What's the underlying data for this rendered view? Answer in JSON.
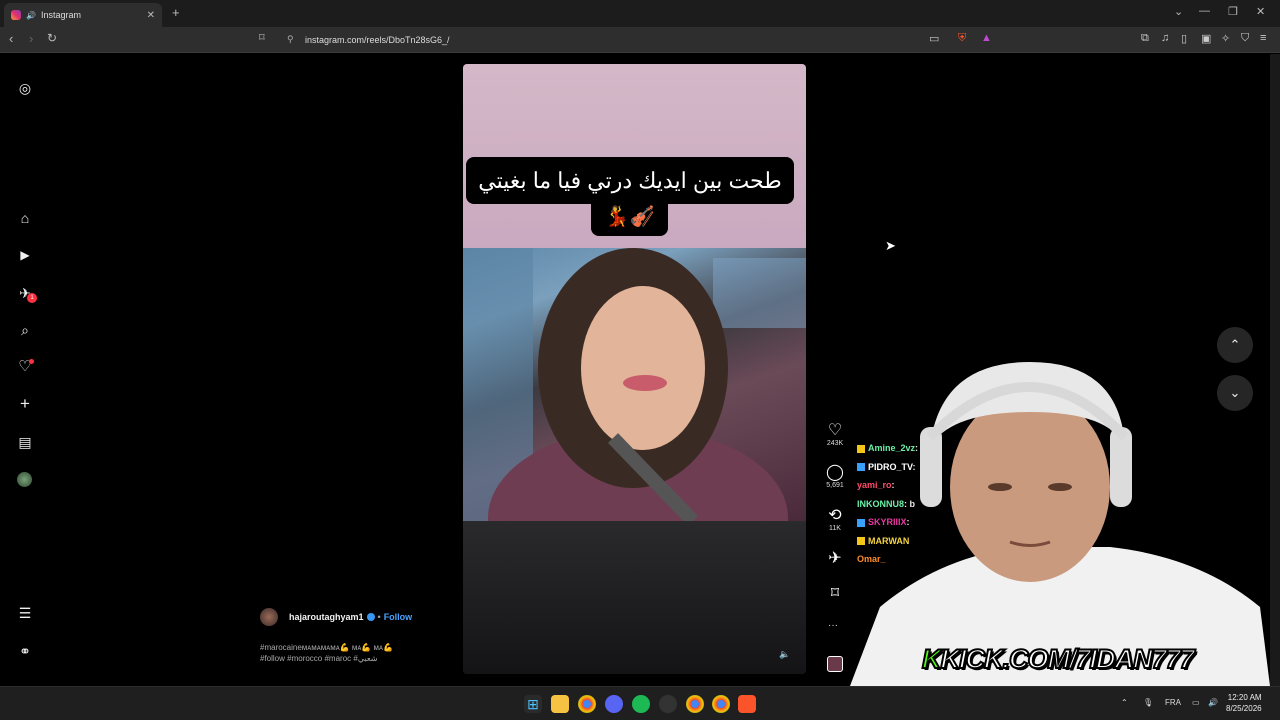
{
  "browser": {
    "tab_title": "Instagram",
    "tab_close": "✕",
    "new_tab": "+",
    "url": "instagram.com/reels/DboTn28sG6_/",
    "win_controls": [
      "⌄",
      "—",
      "❐",
      "✕"
    ]
  },
  "sidebar": {
    "items": [
      {
        "name": "instagram-logo-icon",
        "glyph": "◎"
      },
      {
        "name": "home-icon",
        "glyph": "⌂"
      },
      {
        "name": "reels-icon",
        "glyph": "▶"
      },
      {
        "name": "messages-icon",
        "glyph": "✈",
        "badge": "1"
      },
      {
        "name": "search-icon",
        "glyph": "⌕"
      },
      {
        "name": "notifications-icon",
        "glyph": "♡"
      },
      {
        "name": "create-icon",
        "glyph": "+"
      },
      {
        "name": "dashboard-icon",
        "glyph": "▤"
      },
      {
        "name": "profile-icon",
        "glyph": "●"
      }
    ],
    "more_glyph": "☰",
    "also_from_meta_glyph": "⚭"
  },
  "reel": {
    "caption_line1": "طحت بين ايديك درتي فيا ما بغيتي",
    "caption_line2": "💃🎻",
    "author": "hajaroutaghyam1",
    "follow_label": "Follow",
    "tags_line1": "#marocaineᴍᴀᴍᴀᴍᴀᴍᴀ💪 ᴍᴀ💪 ᴍᴀ💪",
    "tags_line2": "#follow #morocco #maroc #شعبي",
    "sound_glyph": "🔈",
    "actions": {
      "likes": "243K",
      "comments": "5,691",
      "reposts": "11K"
    }
  },
  "nav": {
    "up": "⌃",
    "down": "⌄"
  },
  "stream": {
    "chat": [
      {
        "user": "Amine_2vz",
        "color": "#6cf0a8",
        "text": ": B"
      },
      {
        "user": "PIDRO_TV",
        "color": "#ffffff",
        "text": ":"
      },
      {
        "user": "yami_ro",
        "color": "#ff4a6a",
        "text": ":"
      },
      {
        "user": "INKONNU8",
        "color": "#6cf0a8",
        "text": ": b"
      },
      {
        "user": "SKYRIIIX",
        "color": "#e83aa0",
        "text": ":"
      },
      {
        "user": "MARWAN",
        "color": "#f5d442",
        "text": ""
      },
      {
        "user": "Omar_",
        "color": "#ff8c2a",
        "text": ""
      }
    ],
    "kick_k": "K",
    "kick_rest": "KICK.COM/7IDAN777"
  },
  "taskbar": {
    "lang": "FRA",
    "time": "12:20 AM",
    "date": "8/25/2026"
  }
}
